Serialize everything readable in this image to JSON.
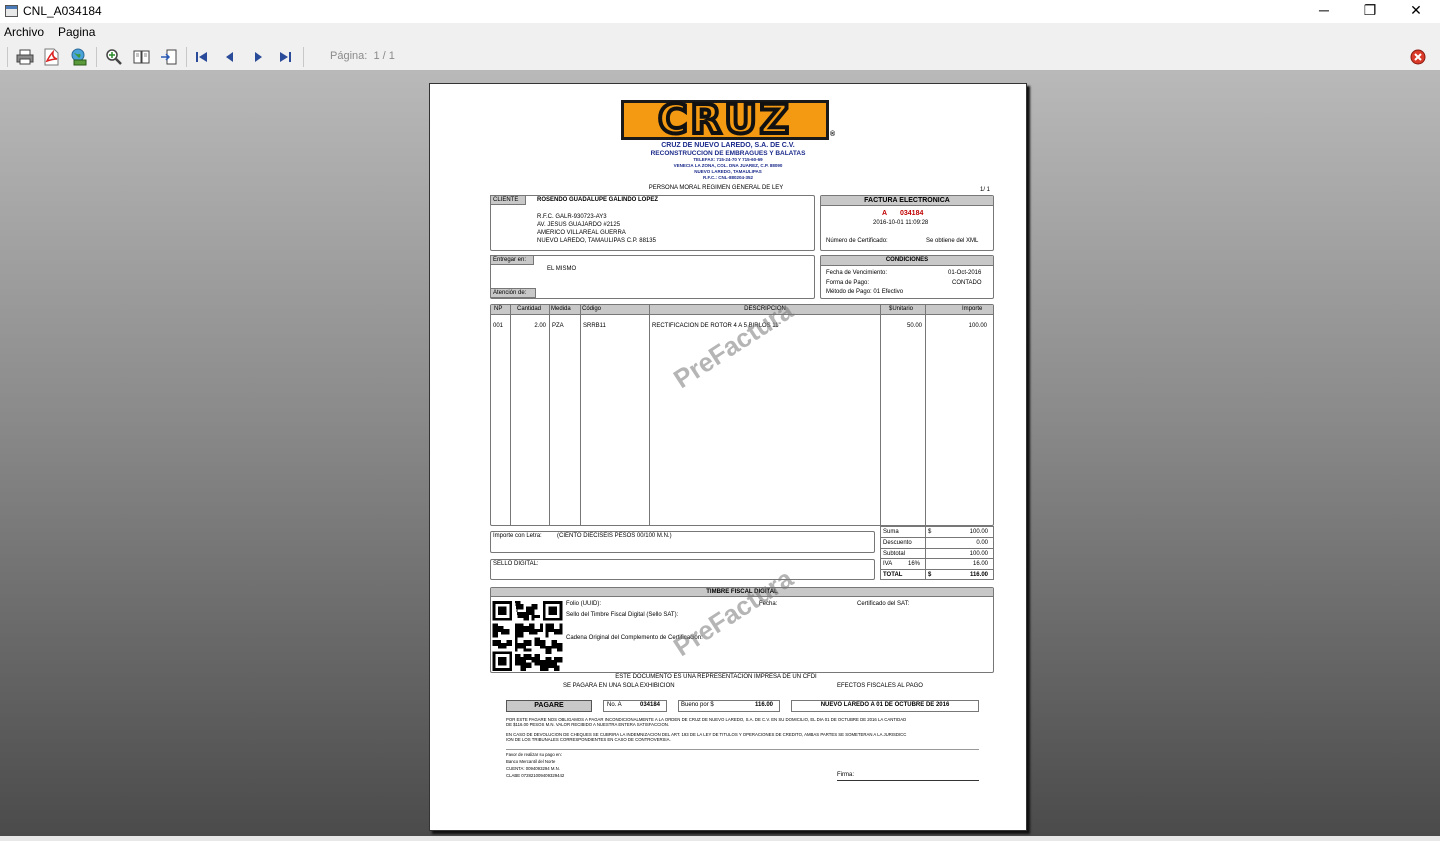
{
  "window": {
    "title": "CNL_A034184",
    "minimize": "─",
    "maximize": "❐",
    "close": "✕"
  },
  "menu": {
    "file": "Archivo",
    "page": "Pagina"
  },
  "toolbar": {
    "page_label": "Página:",
    "page_value": "1 / 1"
  },
  "invoice": {
    "logo_text": "CRUZ",
    "registered": "®",
    "company_name": "CRUZ DE NUEVO LAREDO, S.A. DE C.V.",
    "company_tagline": "RECONSTRUCCION DE EMBRAGUES Y BALATAS",
    "company_phones": "TELEFAX: 715-24-70 Y 715-60-69",
    "company_address": "VENECIA LA ZONA, COL. DNA JUAREZ, C.P. 88090",
    "company_city": "NUEVO LAREDO, TAMAULIPAS",
    "company_rfc": "R.F.C.: CNL-880204-352",
    "regime": "PERSONA MORAL REGIMEN GENERAL DE LEY",
    "page_count": "1/ 1",
    "client": {
      "label": "CLIENTE",
      "name": "ROSENDO GUADALUPE GALINDO LOPEZ",
      "rfc": "R.F.C.   GALR-930723-AY3",
      "street": "AV. JESUS GUAJARDO #2125",
      "colony": "AMERICO VILLAREAL GUERRA",
      "city": "NUEVO LAREDO, TAMAULIPAS C.P. 88135"
    },
    "factura": {
      "title": "FACTURA ELECTRONICA",
      "series": "A",
      "folio": "034184",
      "date": "2016-10-01  11:09:28",
      "cert_label": "Número de Certificado:",
      "cert_value": "Se obtiene del XML"
    },
    "delivery": {
      "label": "Entregar en:",
      "value": "EL MISMO",
      "attention_label": "Atención de:"
    },
    "conditions": {
      "title": "CONDICIONES",
      "due_label": "Fecha de Vencimiento:",
      "due_value": "01-Oct-2016",
      "payment_label": "Forma de Pago:",
      "payment_value": "CONTADO",
      "method_label": "Método de Pago: 01 Efectivo"
    },
    "table": {
      "headers": [
        "NP",
        "Cantidad",
        "Medida",
        "Código",
        "DESCRIPCION",
        "$Unitario",
        "Importe"
      ],
      "rows": [
        [
          "001",
          "2.00",
          "PZA",
          "SRRB11",
          "RECTIFICACION DE ROTOR 4 A 5 BIRLOS 11\"",
          "50.00",
          "100.00"
        ]
      ]
    },
    "amount_words": {
      "label": "Importe con Letra:",
      "value": "(CIENTO DIECISEIS PESOS 00/100 M.N.)"
    },
    "digital_seal_label": "SELLO DIGITAL:",
    "totals": {
      "suma_label": "Suma",
      "suma_cur": "$",
      "suma_value": "100.00",
      "desc_label": "Descuento",
      "desc_value": "0.00",
      "sub_label": "Subtotal",
      "sub_value": "100.00",
      "iva_label": "IVA",
      "iva_rate": "16%",
      "iva_value": "16.00",
      "total_label": "TOTAL",
      "total_cur": "$",
      "total_value": "116.00"
    },
    "stamp": {
      "title": "TIMBRE FISCAL DIGITAL",
      "uuid_label": "Folio (UUID):",
      "date_label": "Fecha:",
      "sat_cert_label": "Certificado del SAT:",
      "sat_seal_label": "Sello del Timbre Fiscal Digital (Sello SAT):",
      "chain_label": "Cadena Original del Complemento de Certificación:"
    },
    "cfdi_note": "ESTE DOCUMENTO ES UNA REPRESENTACION IMPRESA DE UN CFDI",
    "single_payment": "SE PAGARA EN UNA SOLA EXHIBICION",
    "fiscal_effects": "EFECTOS FISCALES AL PAGO",
    "pagare": {
      "title": "PAGARE",
      "no_label": "No.  A",
      "no_value": "034184",
      "bueno_label": "Bueno por  $",
      "bueno_value": "116.00",
      "place_date": "NUEVO LAREDO A 01 DE OCTUBRE DE 2016",
      "text1": "POR ESTE PAGARE NOS OBLIGAMOS A PAGAR INCONDICIONALMENTE A LA ORDEN DE CRUZ DE NUEVO LAREDO, S.A. DE C.V. EN SU DOMICILIO, EL DIA 01 DE OCTUBRE DE 2016 LA CANTIDAD",
      "text1b": "DE $116.00 PESOS M.N. VALOR RECIBIDO A NUESTRA ENTERA SATISFACCION.",
      "text2": "EN CASO DE DEVOLUCION DE CHEQUES SE CUBRIRA LA INDEMNIZACION DEL ART. 193 DE LA LEY DE TITULOS Y OPERACIONES DE CREDITO, AMBAS PARTES SE SOMETERAN A LA JURISDICC",
      "text2b": "ION DE LOS TRIBUNALES CORRESPONDIENTES EN CASO DE CONTROVERSIA.",
      "bank1": "Favor de realizar su pago en:",
      "bank2": "Banco Mercantil del Norte",
      "bank3": "CUENTA: 0094093294 M.N.",
      "bank4": "CLABE 072821009409329442",
      "sign_label": "Firma:"
    },
    "watermark": "PreFactura"
  },
  "colors": {
    "logo_orange": "#f39a12",
    "company_blue": "#1a2a8a",
    "folio_red": "#c00000",
    "header_gray": "#c8c8c8"
  }
}
